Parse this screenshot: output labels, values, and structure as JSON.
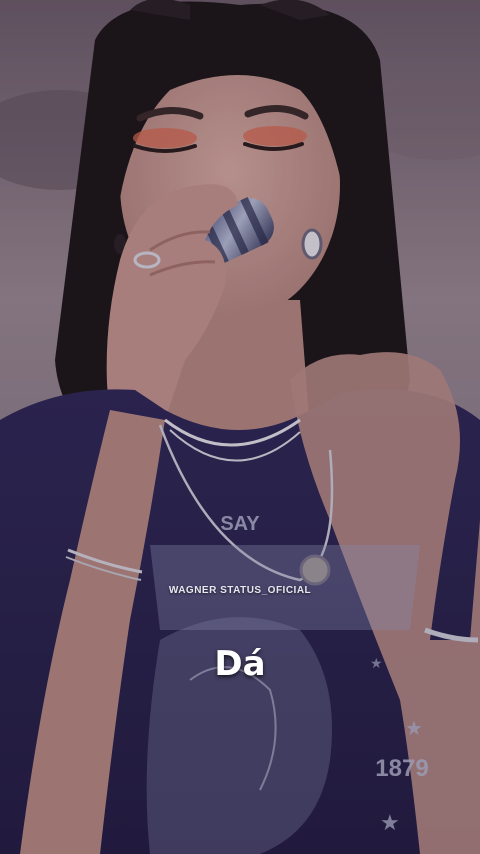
{
  "overlay": {
    "watermark": "WAGNER STATUS_OFICIAL",
    "lyric": "Dá"
  },
  "shirt": {
    "top_text": "SAY",
    "year": "1879"
  },
  "colors": {
    "background_top": "#8a7a86",
    "shirt": "#2a2450",
    "skin": "#c89a92",
    "hair": "#1c1618"
  }
}
